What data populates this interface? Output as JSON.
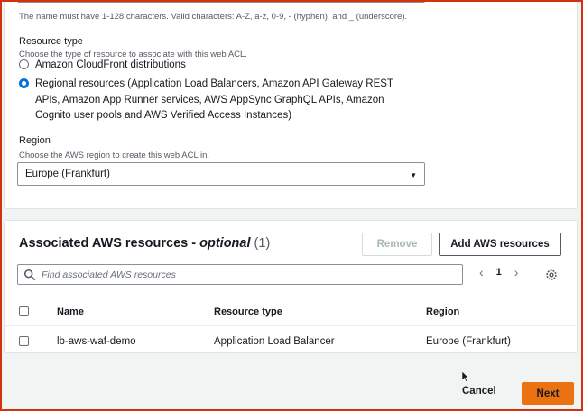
{
  "name_field": {
    "hint": "The name must have 1-128 characters. Valid characters: A-Z, a-z, 0-9, - (hyphen), and _ (underscore)."
  },
  "resource_type": {
    "label": "Resource type",
    "description": "Choose the type of resource to associate with this web ACL.",
    "options": [
      {
        "label": "Amazon CloudFront distributions",
        "selected": false
      },
      {
        "label": "Regional resources (Application Load Balancers, Amazon API Gateway REST APIs, Amazon App Runner services, AWS AppSync GraphQL APIs, Amazon Cognito user pools and AWS Verified Access Instances)",
        "selected": true
      }
    ]
  },
  "region": {
    "label": "Region",
    "description": "Choose the AWS region to create this web ACL in.",
    "value": "Europe (Frankfurt)"
  },
  "associated": {
    "title": "Associated AWS resources - ",
    "optional": "optional",
    "count": "(1)",
    "remove_label": "Remove",
    "add_label": "Add AWS resources",
    "search_placeholder": "Find associated AWS resources",
    "page": "1",
    "columns": [
      "Name",
      "Resource type",
      "Region"
    ],
    "rows": [
      [
        "lb-aws-waf-demo",
        "Application Load Balancer",
        "Europe (Frankfurt)"
      ]
    ]
  },
  "footer": {
    "cancel_label": "Cancel",
    "next_label": "Next"
  },
  "colors": {
    "accent": "#0972d3",
    "primary_button": "#ec7211",
    "frame": "#d13212"
  }
}
